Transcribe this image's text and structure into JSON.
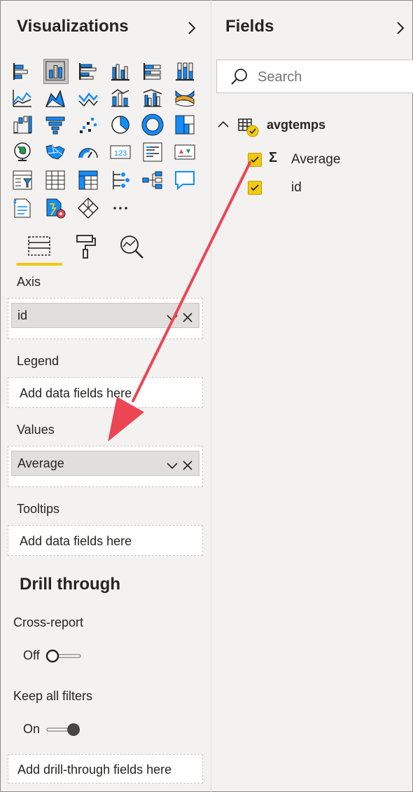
{
  "visualizations": {
    "title": "Visualizations",
    "expand_icon": "chevron-right-icon",
    "icons": [
      "stacked-bar-chart-icon",
      "stacked-column-chart-icon",
      "clustered-bar-chart-icon",
      "clustered-column-chart-icon",
      "100-stacked-bar-chart-icon",
      "100-stacked-column-chart-icon",
      "line-chart-icon",
      "area-chart-icon",
      "stacked-area-chart-icon",
      "line-and-stacked-column-icon",
      "line-and-clustered-column-icon",
      "ribbon-chart-icon",
      "waterfall-chart-icon",
      "funnel-icon",
      "scatter-chart-icon",
      "pie-chart-icon",
      "donut-chart-icon",
      "treemap-icon",
      "map-icon",
      "filled-map-icon",
      "gauge-icon",
      "card-icon",
      "multi-row-card-icon",
      "kpi-icon",
      "slicer-icon",
      "table-icon",
      "matrix-icon",
      "key-influencers-icon",
      "decomposition-tree-icon",
      "qa-icon",
      "smart-narrative-icon",
      "paginated-report-icon",
      "power-apps-icon",
      "more-icon"
    ],
    "selected_icon": "stacked-column-chart-icon",
    "tabs": [
      "fields-tab-icon",
      "format-paint-roller-icon",
      "analytics-magnifier-icon"
    ],
    "wells": {
      "axis": {
        "label": "Axis",
        "value": "id"
      },
      "legend": {
        "label": "Legend",
        "placeholder": "Add data fields here"
      },
      "values": {
        "label": "Values",
        "value": "Average"
      },
      "tooltips": {
        "label": "Tooltips",
        "placeholder": "Add data fields here"
      }
    },
    "drill_through": {
      "title": "Drill through",
      "cross_report": {
        "label": "Cross-report",
        "state": "Off"
      },
      "keep_all_filters": {
        "label": "Keep all filters",
        "state": "On"
      },
      "placeholder": "Add drill-through fields here"
    }
  },
  "fields": {
    "title": "Fields",
    "expand_icon": "chevron-right-icon",
    "search": {
      "placeholder": "Search"
    },
    "table": {
      "name": "avgtemps",
      "expanded": true,
      "fields": [
        {
          "name": "Average",
          "checked": true,
          "type": "sigma"
        },
        {
          "name": "id",
          "checked": true,
          "type": ""
        }
      ]
    }
  },
  "colors": {
    "accent_yellow": "#f2c811",
    "icon_blue": "#118dff",
    "arrow_red": "#ec4654",
    "pane_bg": "#f3f2f1"
  }
}
